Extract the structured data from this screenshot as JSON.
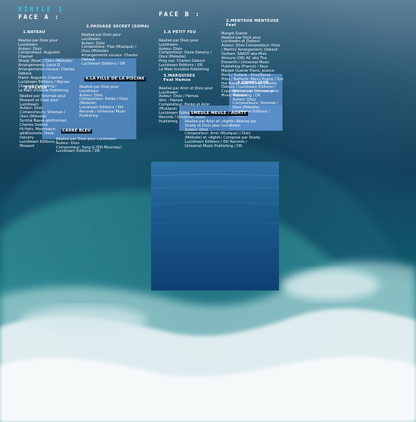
{
  "header": {
    "vinyl": "VINYLE 1",
    "face_a": "FACE A :",
    "face_b": "FACE B :"
  },
  "tracks": {
    "bateau": {
      "title": "1.BATEAU",
      "credits": "Réalisé par Disiz pour\nLucidream\nAuteur: Disiz\nCompositeur: Augustin\nCharnet\nShady (Beat) / Disiz (Mélodie)\nArrangements: Louis D\nArrangements vocaux: Charles\nDebout\nPiano: Augustin Charnet\nLucidream Editions / Warner\nChappell Publishing /\nLa Main Invisible Publishing"
    },
    "splash": {
      "title": "3.SPLASH",
      "credits": "Réalisé par Stromae pour\nMosaert et Disiz pour\nLucidream\nAuteur: Disiz\nCompositeurs: Stromae /\nDisiz (Mélodie)\nSynthé Basse additionnel:\nCharles Debout\nHi-Hats, Mannequin\nadditionnels: Dave\nDaivery\nLucidream Editions /\nMosaert"
    },
    "passage": {
      "title": "2.PASSAGE SECRET (SOMA)",
      "credits": "Réalisé par Disiz pour\nLucidream\nAuteur: Disiz\nCompositeur: Flao (Musique) /\nDisiz (Mélodie)\nArrangements vocaux: Charles\nDebout\nLucidream Editions / DR"
    },
    "piscine": {
      "title": "4.LA FILLE DE LA PISCINE",
      "credits": "Réalisé par Disiz pour\nLucidream\nAuteur: Disiz\nCompositeur: Ponko / Disiz\n(Mélodie)\nLucidream Editions / Elit\nRecords / Universal Music\nPublishing"
    },
    "carre": {
      "title": "CARRÉ BLEU",
      "credits": "Réalisé par Disiz pour Lucidream\nAuteur: Disiz\nCompositeur: Yung G (Elit Mounsey)\nLucidream Editions / DR"
    },
    "petit_feu": {
      "title": "1.A PETIT FEU",
      "credits": "Réalisé par Disiz pour\nLucidream\nAuteur: Disiz\nCompositeur: Dave Daivery /\nDisiz (Mélodie)\nProg sax: Charles Debout\nLucidream Editions / DR\nLa Main Invisible Publishing"
    },
    "marquises": {
      "title": "3.MARQUISES",
      "title_feat": "Feat Hamza",
      "credits": "Réalisé par Amir et Disiz pour\nLucidream\nAuteur: Disiz / Hamza\nVoix : Hamza\nCompositeur: Ponko et Amir\n(Musique)\nLucidream Editions / Elit\nRecords / Universal Music\nPublishing"
    },
    "menteur": {
      "title": "2.MENTEUR MENTEUSE",
      "title_feat": "Feat",
      "credits": "Margot Guené\nRéalisé par Disiz pour\nLucidream et Debout\nAuteur: Disiz Compositeur: Disiz\n/ Martin/ Arrangement: Debout\nGuitare: SAADY aka Mise\nAmoure (DR) AC aka The\nEleventh / Universal Music\nPublishing (France) / Keys\nMargot Guené/ Piano, Jessica\nRock / Guitare - Prou/Basse -\nPlino / Batterie: Manu Dyens / Syn\nthé Basse additionnel: Charles\nDebout / Lucidream Editions /\nCopyright control / Universal\nMusic Publishing / DR"
    },
    "complique": {
      "title": "4.COMPLIQUÉ",
      "credits": "Réalisé par Stromae pour\nMosaert\nAuteur: Disiz\nCompositeurs: Stromae /\nDisiz (Mélodie)\nLucidream Editions /\nMosaert"
    },
    "smeule": {
      "title": "SMEULE MEULE / AGHTT",
      "credits": "Réalisé par Amir et «Aghtt» Réalisé par\nShady et Disiz pour Lucidream\nAuteur: Disiz\nCompositeur: Amir (Musique) / Disiz\n(Mélodie) et «Aghtt» Composé par Shady\nLucidream Editions / Elit Records /\nUniversal Music Publishing / DR"
    }
  },
  "colors": {
    "box": "#5c92ce",
    "vinyl_label": "#2fd0e8",
    "ocean_dark": "#0e3a55",
    "foam": "#f4f8fb"
  }
}
